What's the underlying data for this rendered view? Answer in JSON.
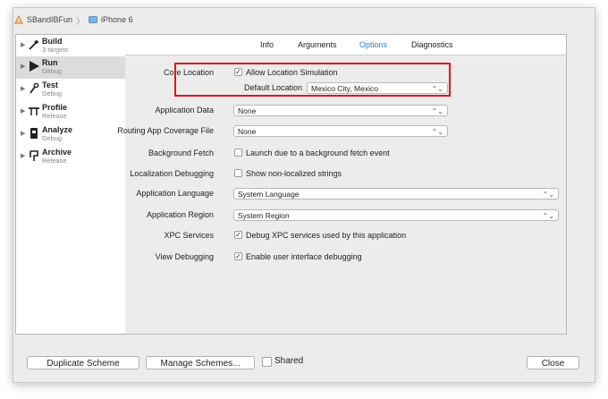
{
  "scheme_bar": {
    "scheme": "SBandIBFun",
    "device": "iPhone 6"
  },
  "sidebar": {
    "items": [
      {
        "title": "Build",
        "subtitle": "3 targets",
        "icon": "hammer-icon"
      },
      {
        "title": "Run",
        "subtitle": "Debug",
        "icon": "play-icon"
      },
      {
        "title": "Test",
        "subtitle": "Debug",
        "icon": "wrench-icon"
      },
      {
        "title": "Profile",
        "subtitle": "Release",
        "icon": "instruments-icon"
      },
      {
        "title": "Analyze",
        "subtitle": "Debug",
        "icon": "analyze-icon"
      },
      {
        "title": "Archive",
        "subtitle": "Release",
        "icon": "archive-icon"
      }
    ],
    "selected": "Run"
  },
  "tabs": [
    "Info",
    "Arguments",
    "Options",
    "Diagnostics"
  ],
  "active_tab": "Options",
  "options": {
    "core_location": {
      "label": "Core Location",
      "checkbox": "Allow Location Simulation",
      "checked": "✓"
    },
    "default_location": {
      "label": "Default Location",
      "value": "Mexico City, Mexico"
    },
    "application_data": {
      "label": "Application Data",
      "value": "None"
    },
    "routing_coverage": {
      "label": "Routing App Coverage File",
      "value": "None"
    },
    "background_fetch": {
      "label": "Background Fetch",
      "checkbox": "Launch due to a background fetch event",
      "checked": ""
    },
    "localization_debugging": {
      "label": "Localization Debugging",
      "checkbox": "Show non-localized strings",
      "checked": ""
    },
    "application_language": {
      "label": "Application Language",
      "value": "System Language"
    },
    "application_region": {
      "label": "Application Region",
      "value": "System Region"
    },
    "xpc_services": {
      "label": "XPC Services",
      "checkbox": "Debug XPC services used by this application",
      "checked": "✓"
    },
    "view_debugging": {
      "label": "View Debugging",
      "checkbox": "Enable user interface debugging",
      "checked": "✓"
    }
  },
  "footer": {
    "duplicate": "Duplicate Scheme",
    "manage": "Manage Schemes...",
    "shared": "Shared",
    "close": "Close"
  },
  "colors": {
    "highlight": "#e0161c",
    "active_tab": "#2a7fd6"
  }
}
